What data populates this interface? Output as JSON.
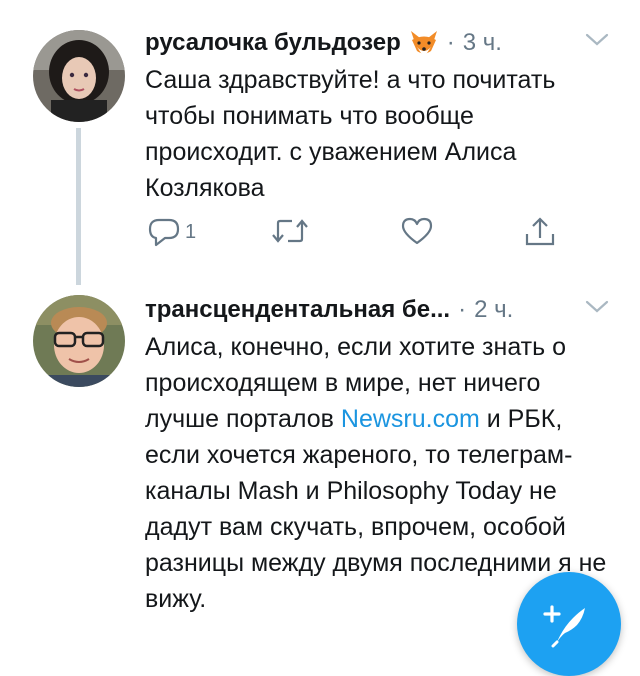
{
  "tweets": [
    {
      "name": "русалочка бульдозер",
      "emoji_icon": "fox-face-icon",
      "separator": "·",
      "time": "3 ч.",
      "body": "Саша здравствуйте! а что почитать чтобы понимать что вообще происходит. с уважением Алиса Козлякова",
      "actions": {
        "reply_count": "1"
      }
    },
    {
      "name": "трансцендентальная бе...",
      "separator": "·",
      "time": "2 ч.",
      "body_parts": [
        "Алиса, конечно, если хотите знать о происходящем в мире, нет ничего лучше порталов ",
        "Newsru.com",
        " и РБК, если хочется жареного, то телеграм-каналы Mash и Philosophy Today не дадут вам скучать, впрочем, особой разницы между двумя последними я не вижу."
      ]
    }
  ],
  "colors": {
    "link": "#1b95e0",
    "secondary_text": "#657786",
    "fab": "#1da1f2",
    "thread_line": "#ccd6dd"
  },
  "fab_icon": "compose-feather-icon"
}
